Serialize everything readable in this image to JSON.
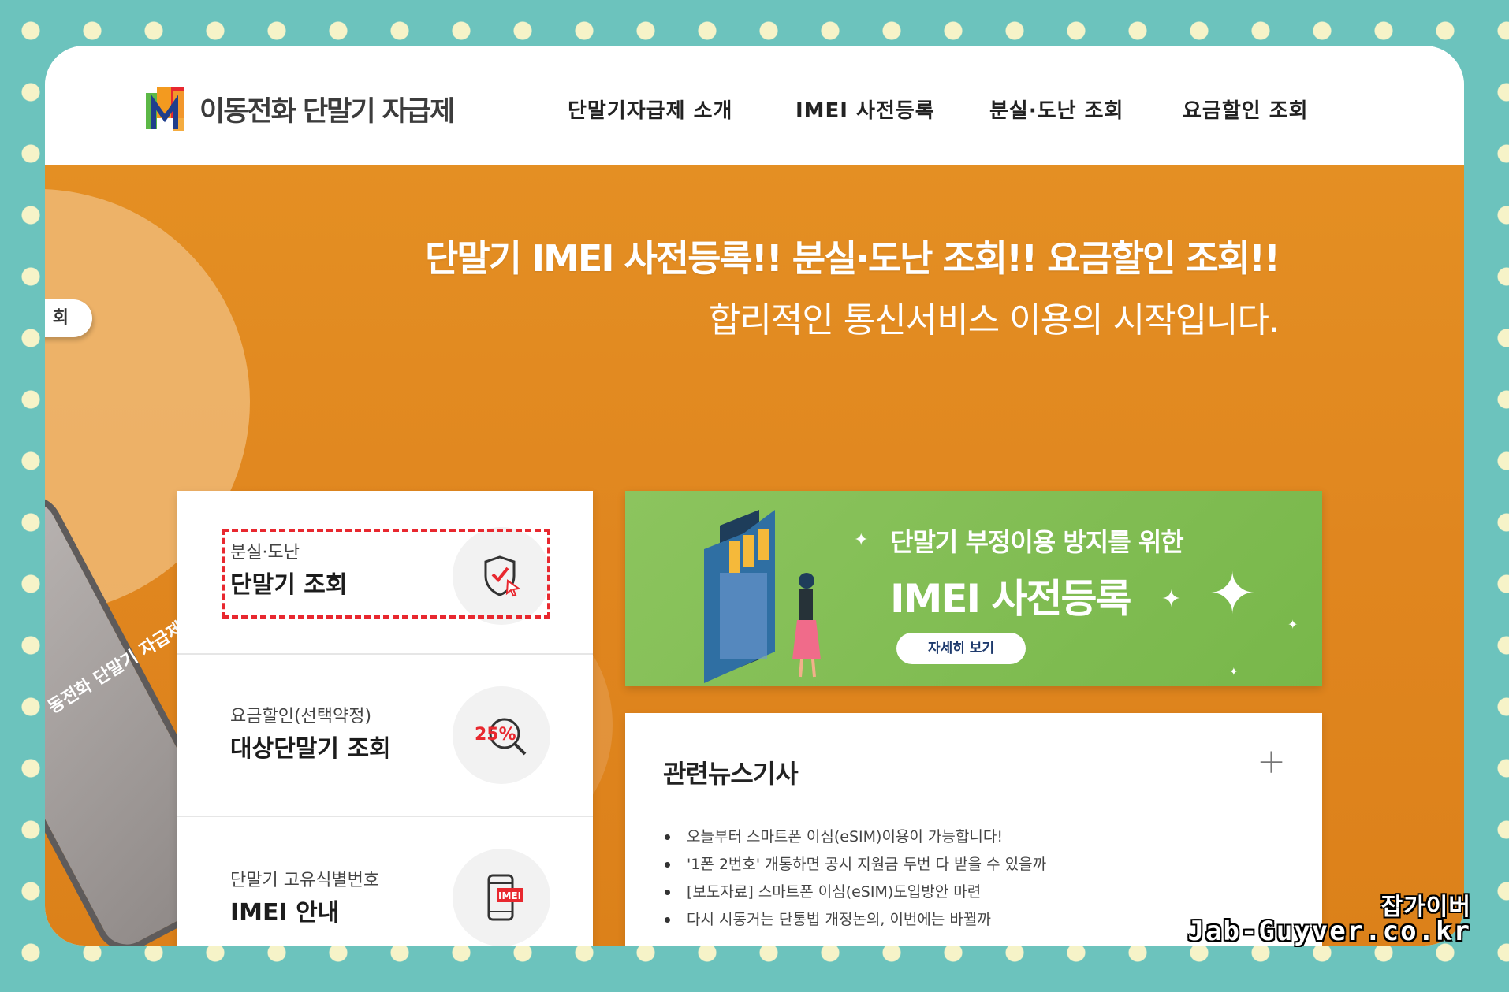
{
  "header": {
    "logo_text": "이동전화 단말기 자급제",
    "nav": [
      {
        "label": "단말기자급제 소개"
      },
      {
        "label": "IMEI 사전등록"
      },
      {
        "label": "분실·도난 조회"
      },
      {
        "label": "요금할인 조회"
      }
    ]
  },
  "hero": {
    "title": "단말기 IMEI 사전등록!! 분실·도난 조회!! 요금할인 조회!!",
    "subtitle": "합리적인 통신서비스 이용의 시작입니다.",
    "side_pill": "회",
    "phone_label": "동전화 단말기 자급제"
  },
  "cards": [
    {
      "small": "분실·도난",
      "big": "단말기 조회",
      "icon": "shield-check-icon"
    },
    {
      "small": "요금할인(선택약정)",
      "big": "대상단말기 조회",
      "icon": "percent-search-icon",
      "icon_text": "25%"
    },
    {
      "small": "단말기 고유식별번호",
      "big": "IMEI 안내",
      "icon": "phone-imei-icon",
      "icon_text": "IMEI"
    }
  ],
  "banner": {
    "subtitle": "단말기 부정이용 방지를 위한",
    "title": "IMEI 사전등록",
    "button": "자세히 보기"
  },
  "news": {
    "title": "관련뉴스기사",
    "plus": "+",
    "items": [
      "오늘부터 스마트폰 이심(eSIM)이용이 가능합니다!",
      "'1폰 2번호' 개통하면 공시 지원금 두번 다 받을 수 있을까",
      "[보도자료] 스마트폰 이심(eSIM)도입방안 마련",
      "다시 시동거는 단통법 개정논의, 이번에는 바뀔까"
    ]
  },
  "watermark": {
    "line1": "잡가이버",
    "line2": "Jab-Guyver.co.kr"
  },
  "colors": {
    "background": "#6cc3bd",
    "hero_orange": "#e08a20",
    "banner_green": "#82bf55",
    "highlight_red": "#e8282f"
  }
}
